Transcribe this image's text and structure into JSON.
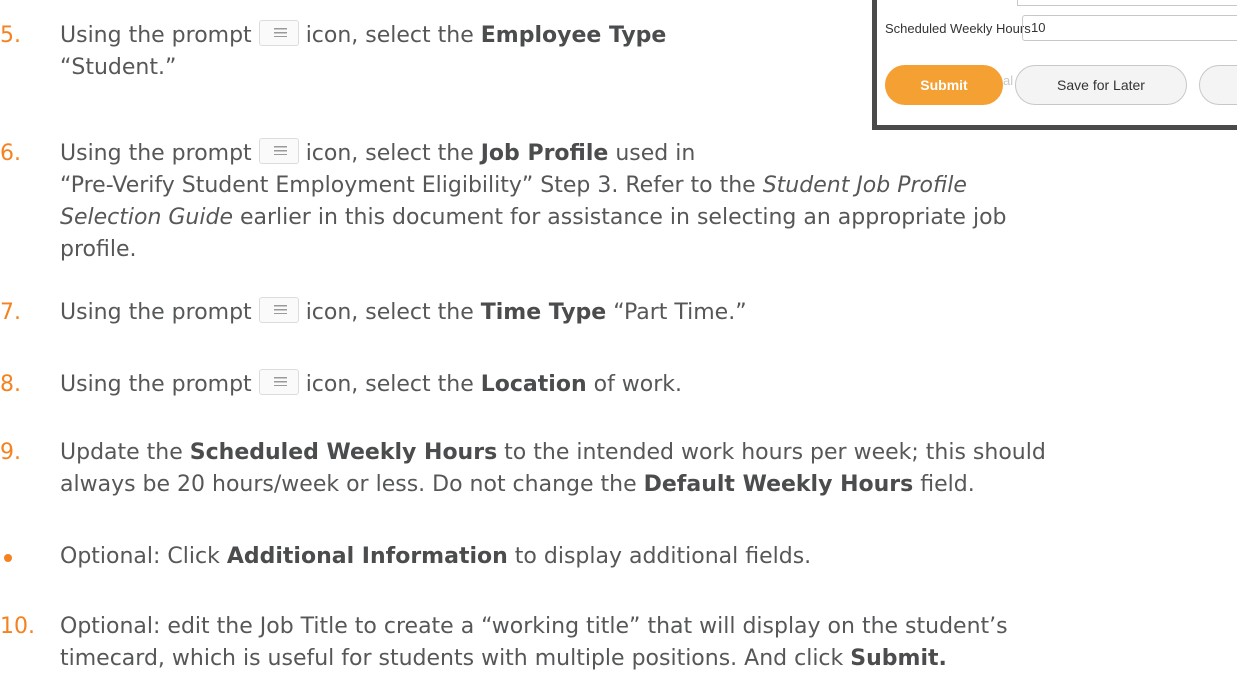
{
  "steps": [
    {
      "num": "5.",
      "l1a": "Using the prompt",
      "l1b": "icon, select the",
      "l1c": "Employee Type",
      "l2": "“Student.”"
    },
    {
      "num": "6.",
      "l1a": "Using the prompt",
      "l1b": "icon, select the",
      "l1c": "Job Profile",
      "l1d": "used in",
      "l2a": "“Pre-Verify Student Employment Eligibility” Step 3. Refer to the",
      "l2b": "Student Job Profile",
      "l3a": "Selection Guide",
      "l3b": "earlier in this document for assistance in selecting an appropriate job",
      "l4": "profile."
    },
    {
      "num": "7.",
      "l1a": "Using the prompt",
      "l1b": "icon, select the",
      "l1c": "Time Type",
      "l1d": "“Part Time.”"
    },
    {
      "num": "8.",
      "l1a": "Using the prompt",
      "l1b": "icon, select the",
      "l1c": "Location",
      "l1d": "of work."
    },
    {
      "num": "9.",
      "l1a": "Update the",
      "l1b": "Scheduled Weekly Hours",
      "l1c": "to the intended work hours per week; this should",
      "l2a": "always be 20 hours/week or less. Do not change the",
      "l2b": "Default Weekly Hours",
      "l2c": "field."
    },
    {
      "l1a": "Optional: Click",
      "l1b": "Additional Information",
      "l1c": "to display additional fields."
    },
    {
      "num": "10.",
      "l1": "Optional: edit the Job Title to create a “working title” that will display on the student’s",
      "l2a": "timecard, which is useful for students with multiple positions. And click",
      "l2b": "Submit."
    }
  ],
  "inset": {
    "label": "Scheduled Weekly Hours",
    "value": "10",
    "submit": "Submit",
    "save": "Save for Later",
    "ghost": "al"
  }
}
